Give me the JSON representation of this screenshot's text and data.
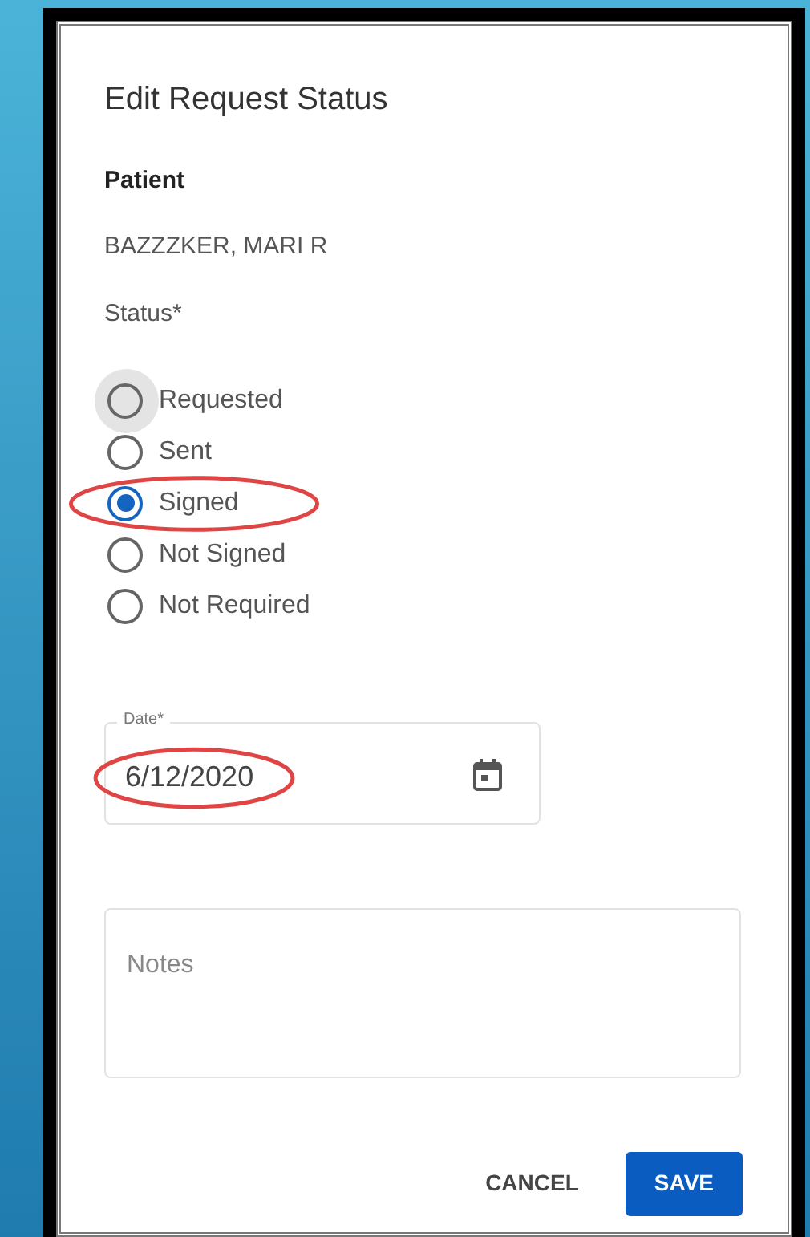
{
  "dialog": {
    "title": "Edit Request Status",
    "patient_label": "Patient",
    "patient_name": "BAZZZKER, MARI R",
    "status_label": "Status*",
    "status_options": [
      {
        "label": "Requested",
        "selected": false,
        "focused": true,
        "circled": false
      },
      {
        "label": "Sent",
        "selected": false,
        "focused": false,
        "circled": false
      },
      {
        "label": "Signed",
        "selected": true,
        "focused": false,
        "circled": true
      },
      {
        "label": "Not Signed",
        "selected": false,
        "focused": false,
        "circled": false
      },
      {
        "label": "Not Required",
        "selected": false,
        "focused": false,
        "circled": false
      }
    ],
    "date_field": {
      "label": "Date*",
      "value": "6/12/2020",
      "circled": true
    },
    "notes_field": {
      "placeholder": "Notes"
    },
    "buttons": [
      {
        "label": "CANCEL",
        "kind": "text"
      },
      {
        "label": "SAVE",
        "kind": "primary"
      }
    ]
  }
}
